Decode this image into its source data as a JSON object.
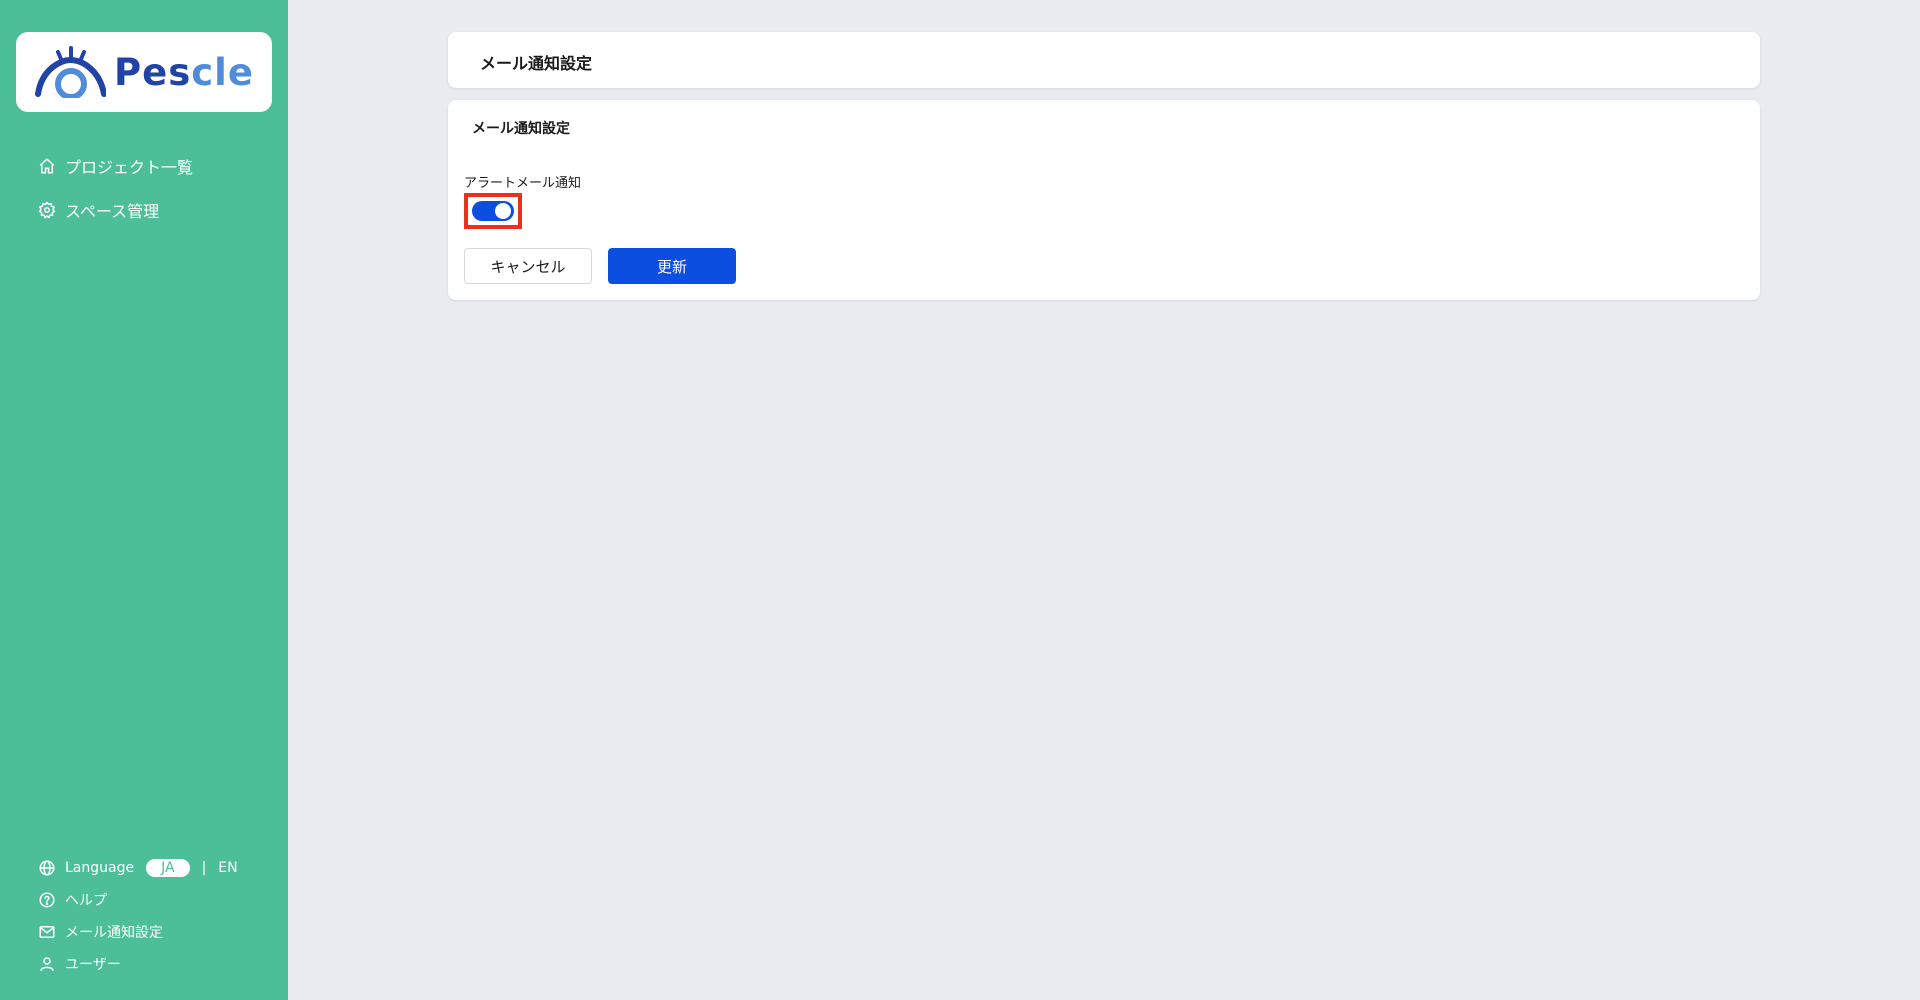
{
  "brand": {
    "name_part1": "Pes",
    "name_part2": "cle",
    "color_primary": "#2143a5",
    "color_secondary": "#4f8ddb"
  },
  "colors": {
    "sidebar_bg": "#4cbe98",
    "accent": "#0b4ee0",
    "highlight": "#e8331c",
    "page_bg": "#e8ebf0"
  },
  "sidebar": {
    "nav": [
      {
        "label": "プロジェクト一覧",
        "icon": "home-icon"
      },
      {
        "label": "スペース管理",
        "icon": "gear-icon"
      }
    ],
    "bottom": {
      "language_label": "Language",
      "lang_ja": "JA",
      "lang_separator": "|",
      "lang_en": "EN",
      "help": "ヘルプ",
      "mail_settings": "メール通知設定",
      "user": "ユーザー"
    }
  },
  "header": {
    "title": "メール通知設定"
  },
  "main": {
    "section_title": "メール通知設定",
    "alert_label": "アラートメール通知",
    "alert_enabled": true,
    "cancel_label": "キャンセル",
    "update_label": "更新"
  }
}
